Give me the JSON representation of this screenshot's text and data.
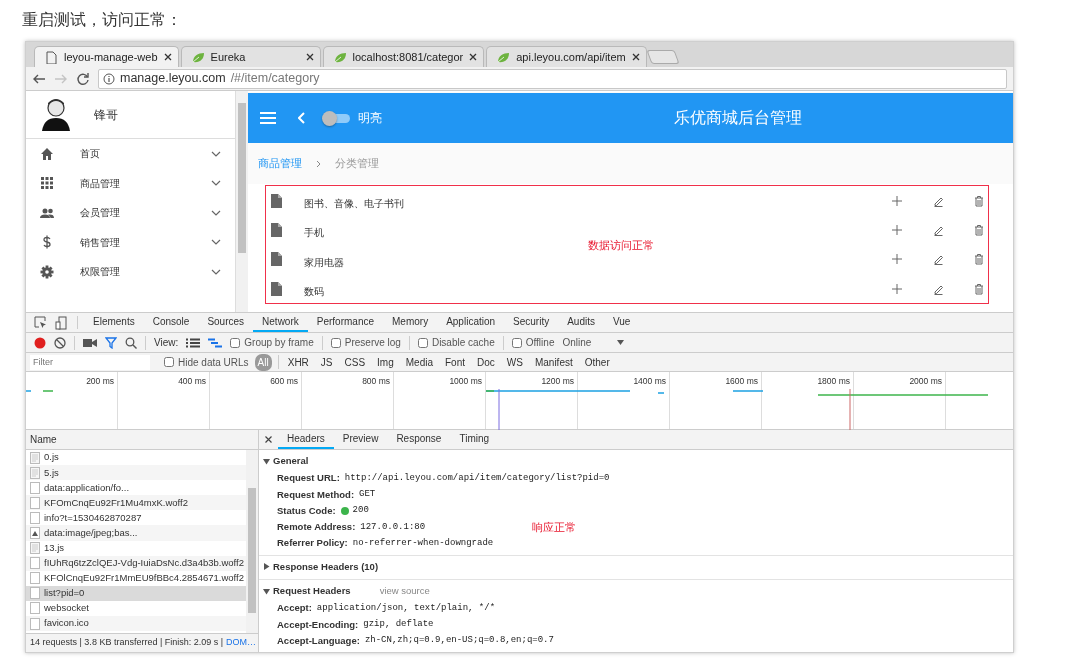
{
  "heading": "重启测试，访问正常：",
  "browser": {
    "tabs": [
      {
        "title": "leyou-manage-web",
        "kind": "page",
        "selected": true
      },
      {
        "title": "Eureka",
        "kind": "leaf",
        "selected": false
      },
      {
        "title": "localhost:8081/categor",
        "kind": "leaf",
        "selected": false
      },
      {
        "title": "api.leyou.com/api/item",
        "kind": "leaf",
        "selected": false
      }
    ],
    "nav": [
      {
        "kind": "back",
        "disabled": false
      },
      {
        "kind": "forward",
        "disabled": true
      },
      {
        "kind": "reload",
        "disabled": false
      }
    ],
    "url_host": "manage.leyou.com",
    "url_path": "/#/item/category"
  },
  "app": {
    "user": "锋哥",
    "menu": [
      {
        "label": "首页",
        "kind": "home"
      },
      {
        "label": "商品管理",
        "kind": "grid"
      },
      {
        "label": "会员管理",
        "kind": "people"
      },
      {
        "label": "销售管理",
        "kind": "dollar"
      },
      {
        "label": "权限管理",
        "kind": "gear"
      }
    ],
    "header": {
      "switch": {
        "label": "明亮",
        "on": false
      },
      "title": "乐优商城后台管理"
    },
    "breadcrumb": [
      {
        "label": "商品管理",
        "active": false
      },
      {
        "label": "分类管理",
        "active": true
      }
    ],
    "categories": [
      {
        "name": "图书、音像、电子书刊"
      },
      {
        "name": "手机"
      },
      {
        "name": "家用电器"
      },
      {
        "name": "数码"
      }
    ],
    "annotation": "数据访问正常"
  },
  "devtools": {
    "panels": [
      {
        "label": "Elements",
        "selected": false
      },
      {
        "label": "Console",
        "selected": false
      },
      {
        "label": "Sources",
        "selected": false
      },
      {
        "label": "Network",
        "selected": true
      },
      {
        "label": "Performance",
        "selected": false
      },
      {
        "label": "Memory",
        "selected": false
      },
      {
        "label": "Application",
        "selected": false
      },
      {
        "label": "Security",
        "selected": false
      },
      {
        "label": "Audits",
        "selected": false
      },
      {
        "label": "Vue",
        "selected": false
      }
    ],
    "recording": true,
    "filter_shown": true,
    "view_label": "View:",
    "view_modes": [
      {
        "kind": "list",
        "selected": false
      },
      {
        "kind": "waterfall",
        "selected": true
      }
    ],
    "options": [
      {
        "label": "Group by frame",
        "checked": false
      },
      {
        "label": "Preserve log",
        "checked": false
      },
      {
        "label": "Disable cache",
        "checked": false
      },
      {
        "label": "Offline",
        "checked": false
      }
    ],
    "throttle": "Online",
    "filter": {
      "placeholder": "Filter"
    },
    "hide_data_urls": {
      "label": "Hide data URLs",
      "checked": false
    },
    "types": [
      {
        "label": "All",
        "selected": true
      },
      {
        "label": "XHR",
        "selected": false
      },
      {
        "label": "JS",
        "selected": false
      },
      {
        "label": "CSS",
        "selected": false
      },
      {
        "label": "Img",
        "selected": false
      },
      {
        "label": "Media",
        "selected": false
      },
      {
        "label": "Font",
        "selected": false
      },
      {
        "label": "Doc",
        "selected": false
      },
      {
        "label": "WS",
        "selected": false
      },
      {
        "label": "Manifest",
        "selected": false
      },
      {
        "label": "Other",
        "selected": false
      }
    ],
    "timeline_ticks": [
      "200 ms",
      "400 ms",
      "600 ms",
      "800 ms",
      "1000 ms",
      "1200 ms",
      "1400 ms",
      "1600 ms",
      "1800 ms",
      "2000 ms"
    ],
    "requests": {
      "column": "Name",
      "rows": [
        {
          "name": "0.js",
          "kind": "script",
          "selected": false
        },
        {
          "name": "5.js",
          "kind": "script",
          "selected": false
        },
        {
          "name": "data:application/fo...",
          "kind": "file",
          "selected": false
        },
        {
          "name": "KFOmCnqEu92Fr1Mu4mxK.woff2",
          "kind": "file",
          "selected": false
        },
        {
          "name": "info?t=1530462870287",
          "kind": "file",
          "selected": false
        },
        {
          "name": "data:image/jpeg;bas...",
          "kind": "image",
          "selected": false
        },
        {
          "name": "13.js",
          "kind": "script",
          "selected": false
        },
        {
          "name": "fIUhRq6tzZclQEJ-Vdg-IuiaDsNc.d3a4b3b.woff2",
          "kind": "file",
          "selected": false
        },
        {
          "name": "KFOlCnqEu92Fr1MmEU9fBBc4.2854671.woff2",
          "kind": "file",
          "selected": false
        },
        {
          "name": "list?pid=0",
          "kind": "file",
          "selected": true
        },
        {
          "name": "websocket",
          "kind": "file",
          "selected": false
        },
        {
          "name": "favicon.ico",
          "kind": "file",
          "selected": false
        }
      ]
    },
    "summary": "14 requests | 3.8 KB transferred | Finish: 2.09 s |",
    "summary_link": "DOM…",
    "detail": {
      "tabs": [
        {
          "label": "Headers",
          "selected": true
        },
        {
          "label": "Preview",
          "selected": false
        },
        {
          "label": "Response",
          "selected": false
        },
        {
          "label": "Timing",
          "selected": false
        }
      ],
      "sections": [
        {
          "title": "General",
          "expanded": true,
          "rows": [
            {
              "key": "Request URL:",
              "value": "http://api.leyou.com/api/item/category/list?pid=0"
            },
            {
              "key": "Request Method:",
              "value": "GET"
            },
            {
              "key": "Status Code:",
              "value": "200",
              "color": "#3cb44b"
            },
            {
              "key": "Remote Address:",
              "value": "127.0.0.1:80"
            },
            {
              "key": "Referrer Policy:",
              "value": "no-referrer-when-downgrade"
            }
          ]
        },
        {
          "title": "Response Headers (10)",
          "expanded": false
        },
        {
          "title": "Request Headers",
          "expanded": true,
          "link": "view source",
          "rows": [
            {
              "key": "Accept:",
              "value": "application/json, text/plain, */*"
            },
            {
              "key": "Accept-Encoding:",
              "value": "gzip, deflate"
            },
            {
              "key": "Accept-Language:",
              "value": "zh-CN,zh;q=0.9,en-US;q=0.8,en;q=0.7"
            }
          ]
        }
      ],
      "annotation": "响应正常"
    }
  }
}
